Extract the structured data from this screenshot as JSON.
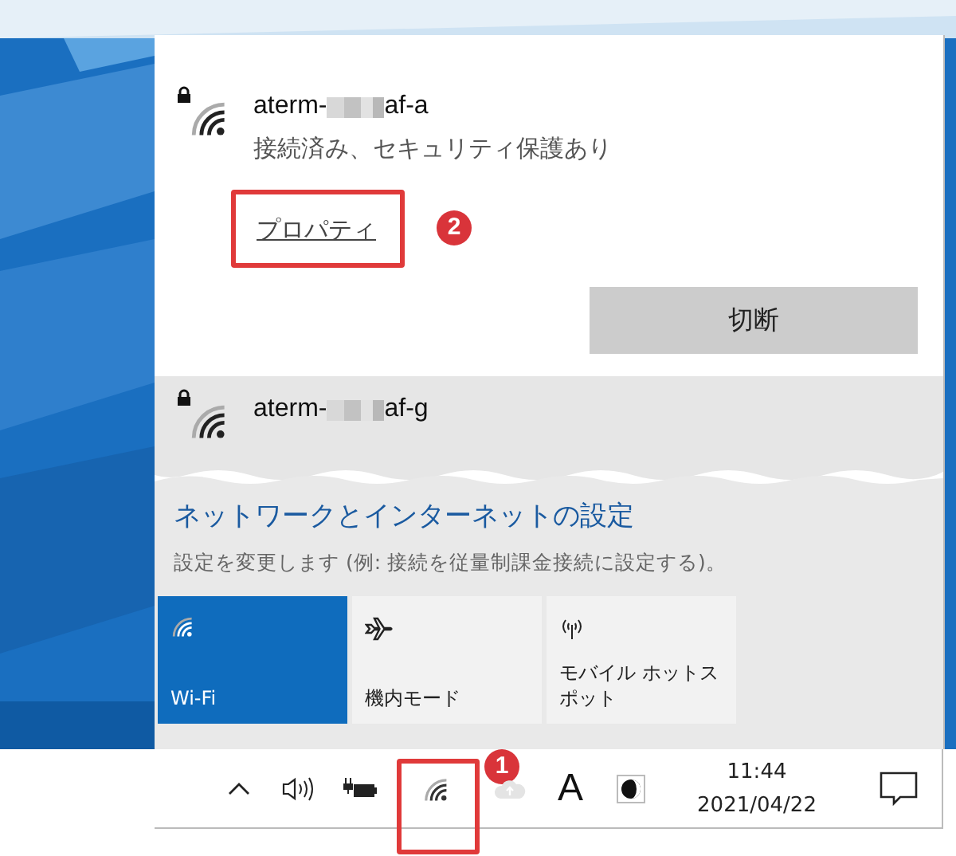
{
  "connected_network": {
    "ssid_start": "aterm-",
    "ssid_end": "af-a",
    "secured": true,
    "status": "接続済み、セキュリティ保護あり",
    "properties_link": "プロパティ",
    "properties_callout": "2",
    "disconnect_button": "切断"
  },
  "networks": [
    {
      "ssid_start": "aterm-",
      "ssid_end": "af-g",
      "secured": true
    }
  ],
  "settings": {
    "title": "ネットワークとインターネットの設定",
    "subtitle": "設定を変更します (例: 接続を従量制課金接続に設定する)。"
  },
  "quick_actions": [
    {
      "kind": "wifi",
      "lines": [
        "Wi-Fi"
      ],
      "on": true
    },
    {
      "kind": "airplane",
      "lines": [
        "機内モード"
      ],
      "on": false
    },
    {
      "kind": "hotspot",
      "lines": [
        "モバイル ホットス",
        "ポット"
      ],
      "on": false
    }
  ],
  "taskbar": {
    "wifi_callout": "1",
    "ime_mode": "A",
    "clock_time": "11:44",
    "clock_date": "2021/04/22"
  }
}
